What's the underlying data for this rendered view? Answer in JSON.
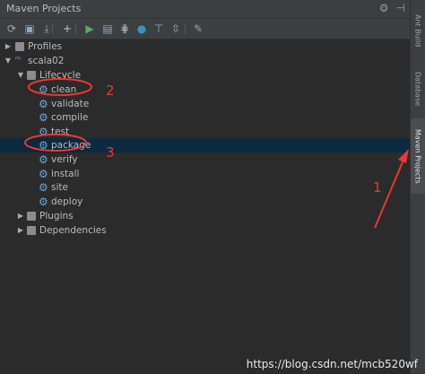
{
  "window": {
    "title": "Maven Projects"
  },
  "titlebar_icons": [
    "gear-icon",
    "minimize-icon"
  ],
  "toolbar": {
    "buttons": [
      {
        "name": "reimport-icon",
        "glyph": "⟳",
        "color": "#a0a0a0"
      },
      {
        "name": "generate-sources-icon",
        "glyph": "▣",
        "color": "#8ba8c8"
      },
      {
        "name": "download-icon",
        "glyph": "⤓",
        "color": "#a0a0a0"
      },
      {
        "name": "add-icon",
        "glyph": "+",
        "color": "#c0c0c0"
      },
      {
        "name": "run-icon",
        "glyph": "▶",
        "color": "#59a869"
      },
      {
        "name": "execute-goal-icon",
        "glyph": "▤",
        "color": "#8ba8c8"
      },
      {
        "name": "toggle-offline-icon",
        "glyph": "⋕",
        "color": "#c0c0c0"
      },
      {
        "name": "skip-tests-icon",
        "glyph": "●",
        "color": "#3592c4"
      },
      {
        "name": "show-dependencies-icon",
        "glyph": "⊤",
        "color": "#8ba8c8"
      },
      {
        "name": "collapse-all-icon",
        "glyph": "⇳",
        "color": "#a0a0a0"
      },
      {
        "name": "settings-wrench-icon",
        "glyph": "✎",
        "color": "#a0a0a0"
      }
    ]
  },
  "tree": {
    "profiles": "Profiles",
    "project": "scala02",
    "lifecycle": "Lifecycle",
    "phases": [
      "clean",
      "validate",
      "compile",
      "test",
      "package",
      "verify",
      "install",
      "site",
      "deploy"
    ],
    "selected_phase": "package",
    "plugins": "Plugins",
    "dependencies": "Dependencies"
  },
  "sidebar": {
    "tabs": [
      {
        "label": "Ant Build",
        "active": false
      },
      {
        "label": "Database",
        "active": false
      },
      {
        "label": "Maven Projects",
        "active": true
      }
    ]
  },
  "annotations": {
    "num1": "1",
    "num2": "2",
    "num3": "3",
    "color": "#e53935"
  },
  "watermark": "https://blog.csdn.net/mcb520wf"
}
